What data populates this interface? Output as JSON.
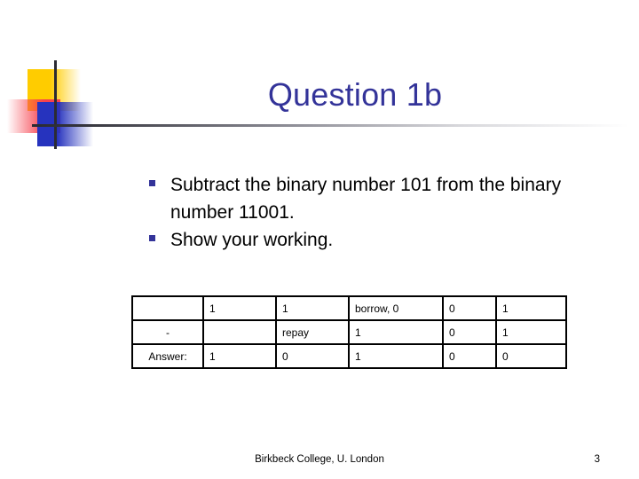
{
  "slide": {
    "title": "Question 1b",
    "bullets": [
      "Subtract the binary number 101 from the binary number 11001.",
      "Show your working."
    ],
    "table": {
      "rows": [
        {
          "label": "",
          "cells": [
            "1",
            "1",
            "borrow, 0",
            "0",
            "1"
          ]
        },
        {
          "label": "-",
          "cells": [
            "",
            "repay",
            "1",
            "0",
            "1"
          ]
        },
        {
          "label": "Answer:",
          "cells": [
            "1",
            "0",
            "1",
            "0",
            "0"
          ]
        }
      ]
    },
    "footer": {
      "credit": "Birkbeck College, U. London",
      "page_number": "3"
    },
    "colors": {
      "title": "#333399",
      "bullet": "#333399",
      "logo_yellow": "#FFCC00",
      "logo_red": "#F6414E",
      "logo_blue": "#2633BE",
      "rule": "#2B2B33",
      "table_border": "#000000",
      "background": "#FFFFFF"
    }
  }
}
